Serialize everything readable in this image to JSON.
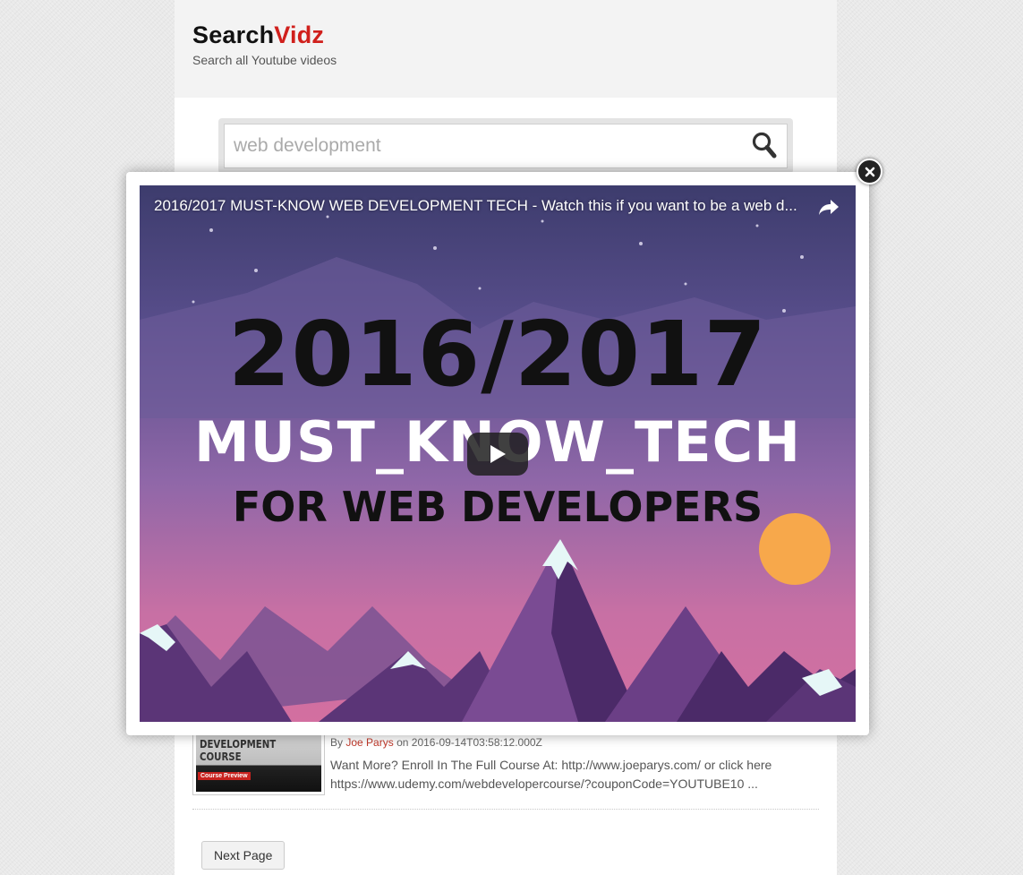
{
  "header": {
    "logo_part1": "Search",
    "logo_part2": "Vidz",
    "tagline": "Search all Youtube videos"
  },
  "search": {
    "value": "web development",
    "placeholder": "web development",
    "button_icon": "search-icon"
  },
  "modal": {
    "video_title": "2016/2017 MUST-KNOW WEB DEVELOPMENT TECH - Watch this if you want to be a web d...",
    "thumbnail_line1": "2016/2017",
    "thumbnail_line2": "MUST_KNOW_TECH",
    "thumbnail_line3": "FOR WEB DEVELOPERS",
    "share_icon": "share-icon",
    "play_icon": "play-icon",
    "close_icon": "close-icon"
  },
  "result": {
    "thumb_text": "DEVELOPMENT COURSE",
    "thumb_badge": "Course Preview",
    "by_label": "By",
    "author": "Joe Parys",
    "on_label": "on",
    "date": "2016-09-14T03:58:12.000Z",
    "description": "Want More? Enroll In The Full Course At: http://www.joeparys.com/ or click here https://www.udemy.com/webdevelopercourse/?couponCode=YOUTUBE10 ..."
  },
  "pagination": {
    "next_label": "Next Page"
  },
  "colors": {
    "accent": "#d0201c",
    "author_link": "#c0392b"
  }
}
